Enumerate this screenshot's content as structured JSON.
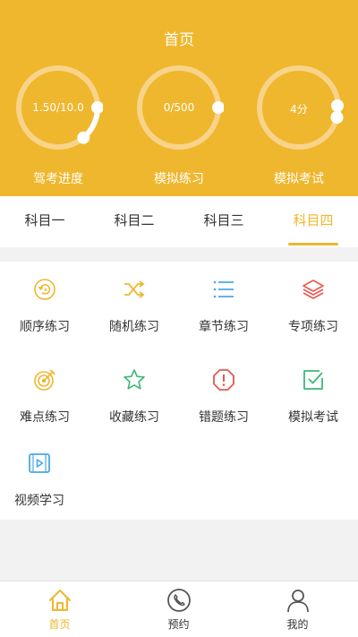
{
  "header": {
    "title": "首页",
    "gauges": [
      {
        "value_text": "1.50/10.0",
        "label": "驾考进度",
        "progress": 0.15
      },
      {
        "value_text": "0/500",
        "label": "模拟练习",
        "progress": 0
      },
      {
        "value_text": "4分",
        "label": "模拟考试",
        "progress": 0.04
      }
    ]
  },
  "tabs": {
    "items": [
      "科目一",
      "科目二",
      "科目三",
      "科目四"
    ],
    "active_index": 3
  },
  "practice": {
    "items": [
      {
        "label": "顺序练习",
        "icon": "sequence-icon",
        "color": "#efb72e"
      },
      {
        "label": "随机练习",
        "icon": "shuffle-icon",
        "color": "#efb72e"
      },
      {
        "label": "章节练习",
        "icon": "list-icon",
        "color": "#4aa8e8"
      },
      {
        "label": "专项练习",
        "icon": "layers-icon",
        "color": "#e8584f"
      },
      {
        "label": "难点练习",
        "icon": "target-icon",
        "color": "#efb72e"
      },
      {
        "label": "收藏练习",
        "icon": "star-icon",
        "color": "#3cb878"
      },
      {
        "label": "错题练习",
        "icon": "error-icon",
        "color": "#e8584f"
      },
      {
        "label": "模拟考试",
        "icon": "check-box-icon",
        "color": "#3cb878"
      },
      {
        "label": "视频学习",
        "icon": "video-icon",
        "color": "#4aa8e8"
      }
    ]
  },
  "tabbar": {
    "items": [
      {
        "label": "首页",
        "icon": "home-icon"
      },
      {
        "label": "预约",
        "icon": "phone-icon"
      },
      {
        "label": "我的",
        "icon": "user-icon"
      }
    ],
    "active_index": 0
  },
  "colors": {
    "accent": "#efb72e",
    "ring_track": "#f8d38a",
    "text": "#333333"
  }
}
